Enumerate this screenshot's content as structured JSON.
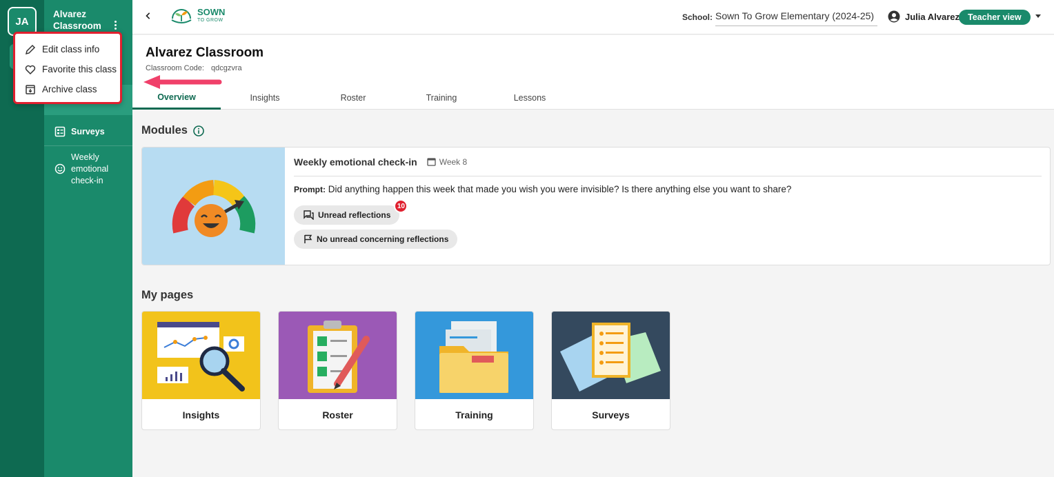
{
  "rail": {
    "avatar_initials": "JA"
  },
  "sidebar": {
    "class_name_line1": "Alvarez",
    "class_name_line2": "Classroom",
    "items": [
      {
        "label": "Surveys",
        "icon": "survey-icon"
      },
      {
        "label_line1": "Weekly",
        "label_line2": "emotional",
        "label_line3": "check-in",
        "icon": "smiley-icon"
      }
    ]
  },
  "class_menu": {
    "items": [
      {
        "label": "Edit class info",
        "icon": "pencil-icon"
      },
      {
        "label": "Favorite this class",
        "icon": "heart-icon"
      },
      {
        "label": "Archive class",
        "icon": "archive-icon"
      }
    ]
  },
  "header": {
    "logo_line1": "SOWN",
    "logo_line2": "TO GROW",
    "school_label": "School:",
    "school_value": "Sown To Grow Elementary (2024-25)",
    "user_name": "Julia Alvarez",
    "view_button": "Teacher view"
  },
  "page": {
    "title": "Alvarez Classroom",
    "code_label": "Classroom Code:",
    "code_value": "qdcgzvra",
    "tabs": [
      "Overview",
      "Insights",
      "Roster",
      "Training",
      "Lessons"
    ],
    "active_tab": "Overview"
  },
  "modules": {
    "title": "Modules",
    "card": {
      "title": "Weekly emotional check-in",
      "week": "Week 8",
      "prompt_label": "Prompt:",
      "prompt_text": "Did anything happen this week that made you wish you were invisible? Is there anything else you want to share?",
      "chip_unread": "Unread reflections",
      "unread_count": "10",
      "chip_concerning": "No unread concerning reflections"
    }
  },
  "my_pages": {
    "title": "My pages",
    "cards": [
      {
        "label": "Insights",
        "bg": "#f2c31b"
      },
      {
        "label": "Roster",
        "bg": "#9b59b6"
      },
      {
        "label": "Training",
        "bg": "#3498db"
      },
      {
        "label": "Surveys",
        "bg": "#34495e"
      }
    ]
  },
  "colors": {
    "brand_green": "#1a8a6b",
    "dark_green": "#0e6a51",
    "alert_red": "#e0202f"
  }
}
